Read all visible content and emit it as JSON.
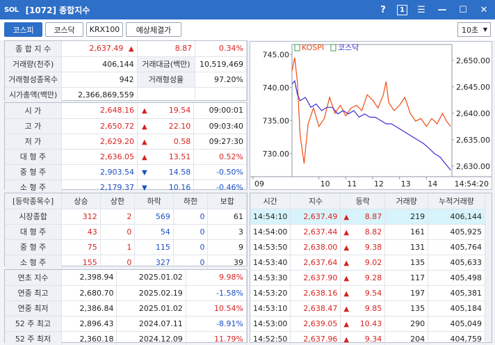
{
  "window": {
    "logo": "SOL",
    "title": "[1072] 종합지수",
    "help": "?",
    "page_badge": "1"
  },
  "toolbar": {
    "tabs": [
      {
        "label": "코스피",
        "active": true
      },
      {
        "label": "코스닥",
        "active": false
      },
      {
        "label": "KRX100",
        "active": false
      },
      {
        "label": "예상체결가",
        "active": false
      }
    ],
    "interval": "10초"
  },
  "summary": {
    "rows": [
      {
        "l1": "종 합 지 수",
        "v1": "2,637.49",
        "l2": "",
        "v2": "8.87",
        "v3": "0.34%"
      },
      {
        "l1": "거래량(천주)",
        "v1": "406,144",
        "l2": "거래대금(백만)",
        "v2": "10,519,469"
      },
      {
        "l1": "거래형성종목수",
        "v1": "942",
        "l2": "거래형성율",
        "v2": "97.20%"
      },
      {
        "l1": "시가총액(백만)",
        "v1": "2,366,869,559"
      }
    ]
  },
  "prices": {
    "rows": [
      {
        "label": "시       가",
        "value": "2,648.16",
        "dir": "up",
        "change": "19.54",
        "extra": "09:00:01"
      },
      {
        "label": "고       가",
        "value": "2,650.72",
        "dir": "up",
        "change": "22.10",
        "extra": "09:03:40"
      },
      {
        "label": "저       가",
        "value": "2,629.20",
        "dir": "up",
        "change": "0.58",
        "extra": "09:27:30"
      },
      {
        "label": "대 형 주",
        "value": "2,636.05",
        "dir": "up",
        "change": "13.51",
        "extra": "0.52%"
      },
      {
        "label": "중 형 주",
        "value": "2,903.54",
        "dir": "dn",
        "change": "14.58",
        "extra": "-0.50%"
      },
      {
        "label": "소 형 주",
        "value": "2,179.37",
        "dir": "dn",
        "change": "10.16",
        "extra": "-0.46%"
      }
    ]
  },
  "breadth": {
    "headers": [
      "[등락종목수]",
      "상승",
      "상한",
      "하락",
      "하한",
      "보합"
    ],
    "rows": [
      {
        "label": "시장종합",
        "v": [
          "312",
          "2",
          "569",
          "0",
          "61"
        ]
      },
      {
        "label": "대 형 주",
        "v": [
          "43",
          "0",
          "54",
          "0",
          "3"
        ]
      },
      {
        "label": "중 형 주",
        "v": [
          "75",
          "1",
          "115",
          "0",
          "9"
        ]
      },
      {
        "label": "소 형 주",
        "v": [
          "155",
          "0",
          "327",
          "0",
          "39"
        ]
      }
    ]
  },
  "history": {
    "rows": [
      {
        "label": "연초  지수",
        "value": "2,398.94",
        "date": "2025.01.02",
        "pct": "9.98%"
      },
      {
        "label": "연중  최고",
        "value": "2,680.70",
        "date": "2025.02.19",
        "pct": "-1.58%"
      },
      {
        "label": "연중  최저",
        "value": "2,386.84",
        "date": "2025.01.02",
        "pct": "10.54%"
      },
      {
        "label": "52 주 최고",
        "value": "2,896.43",
        "date": "2024.07.11",
        "pct": "-8.91%"
      },
      {
        "label": "52 주 최저",
        "value": "2,360.18",
        "date": "2024.12.09",
        "pct": "11.79%"
      }
    ]
  },
  "ticks": {
    "headers": [
      "시간",
      "지수",
      "등락",
      "거래량",
      "누적거래량"
    ],
    "rows": [
      {
        "time": "14:54:10",
        "index": "2,637.49",
        "change": "8.87",
        "vol": "219",
        "cum": "406,144",
        "selected": true
      },
      {
        "time": "14:54:00",
        "index": "2,637.44",
        "change": "8.82",
        "vol": "161",
        "cum": "405,925"
      },
      {
        "time": "14:53:50",
        "index": "2,638.00",
        "change": "9.38",
        "vol": "131",
        "cum": "405,764"
      },
      {
        "time": "14:53:40",
        "index": "2,637.64",
        "change": "9.02",
        "vol": "135",
        "cum": "405,633"
      },
      {
        "time": "14:53:30",
        "index": "2,637.90",
        "change": "9.28",
        "vol": "117",
        "cum": "405,498"
      },
      {
        "time": "14:53:20",
        "index": "2,638.16",
        "change": "9.54",
        "vol": "197",
        "cum": "405,381"
      },
      {
        "time": "14:53:10",
        "index": "2,638.47",
        "change": "9.85",
        "vol": "135",
        "cum": "405,184"
      },
      {
        "time": "14:53:00",
        "index": "2,639.05",
        "change": "10.43",
        "vol": "290",
        "cum": "405,049"
      },
      {
        "time": "14:52:50",
        "index": "2,637.96",
        "change": "9.34",
        "vol": "204",
        "cum": "404,759"
      }
    ]
  },
  "colors": {
    "kospi": "#ee4b0f",
    "kosdaq": "#3a2bd0",
    "up": "#d6231f",
    "down": "#1b4fc4"
  },
  "chart_data": {
    "type": "line",
    "legend": [
      "KOSPI",
      "코스닥"
    ],
    "legend_placement": "top-left",
    "left_axis_ticks": [
      "745.00",
      "740.00",
      "735.00",
      "730.00"
    ],
    "left_ylim": [
      726.5,
      746.5
    ],
    "right_axis_ticks": [
      "2,650.00",
      "2,645.00",
      "2,640.00",
      "2,635.00",
      "2,630.00"
    ],
    "right_ylim": [
      2628.0,
      2653.0
    ],
    "x_ticks": [
      "09",
      "10",
      "11",
      "12",
      "13",
      "14",
      "14:54:20"
    ],
    "x_tick_hours": [
      9,
      10,
      11,
      12,
      13,
      14
    ],
    "x_end_label": "14:54:20",
    "series": [
      {
        "name": "KOSPI",
        "axis": "right",
        "x": [
          9.0,
          9.1,
          9.2,
          9.3,
          9.45,
          9.6,
          9.8,
          10.0,
          10.2,
          10.4,
          10.6,
          10.8,
          11.0,
          11.2,
          11.4,
          11.6,
          11.8,
          12.0,
          12.2,
          12.4,
          12.5,
          12.6,
          12.8,
          13.0,
          13.2,
          13.4,
          13.6,
          13.8,
          14.0,
          14.2,
          14.4,
          14.6,
          14.75,
          14.9
        ],
        "y": [
          2648.0,
          2650.5,
          2646.0,
          2636.0,
          2630.5,
          2638.0,
          2641.0,
          2637.5,
          2639.0,
          2643.0,
          2640.0,
          2641.5,
          2639.5,
          2641.0,
          2641.5,
          2640.5,
          2643.5,
          2642.5,
          2641.0,
          2643.5,
          2646.0,
          2642.0,
          2640.5,
          2641.5,
          2643.0,
          2640.0,
          2638.5,
          2639.0,
          2637.5,
          2639.0,
          2638.0,
          2640.0,
          2638.5,
          2637.5
        ]
      },
      {
        "name": "코스닥",
        "axis": "left",
        "x": [
          9.0,
          9.1,
          9.2,
          9.3,
          9.5,
          9.7,
          9.9,
          10.1,
          10.3,
          10.5,
          10.7,
          10.9,
          11.1,
          11.3,
          11.5,
          11.7,
          11.9,
          12.1,
          12.3,
          12.5,
          12.7,
          12.9,
          13.1,
          13.3,
          13.5,
          13.7,
          13.9,
          14.1,
          14.3,
          14.5,
          14.7,
          14.9
        ],
        "y": [
          740.5,
          741.0,
          739.0,
          738.0,
          738.5,
          737.0,
          737.5,
          736.5,
          737.0,
          737.0,
          736.0,
          736.5,
          736.0,
          736.5,
          735.5,
          736.0,
          735.5,
          735.5,
          735.0,
          734.5,
          734.5,
          734.0,
          733.5,
          733.0,
          732.5,
          732.0,
          731.5,
          730.8,
          730.0,
          729.5,
          728.5,
          727.5
        ]
      }
    ]
  }
}
